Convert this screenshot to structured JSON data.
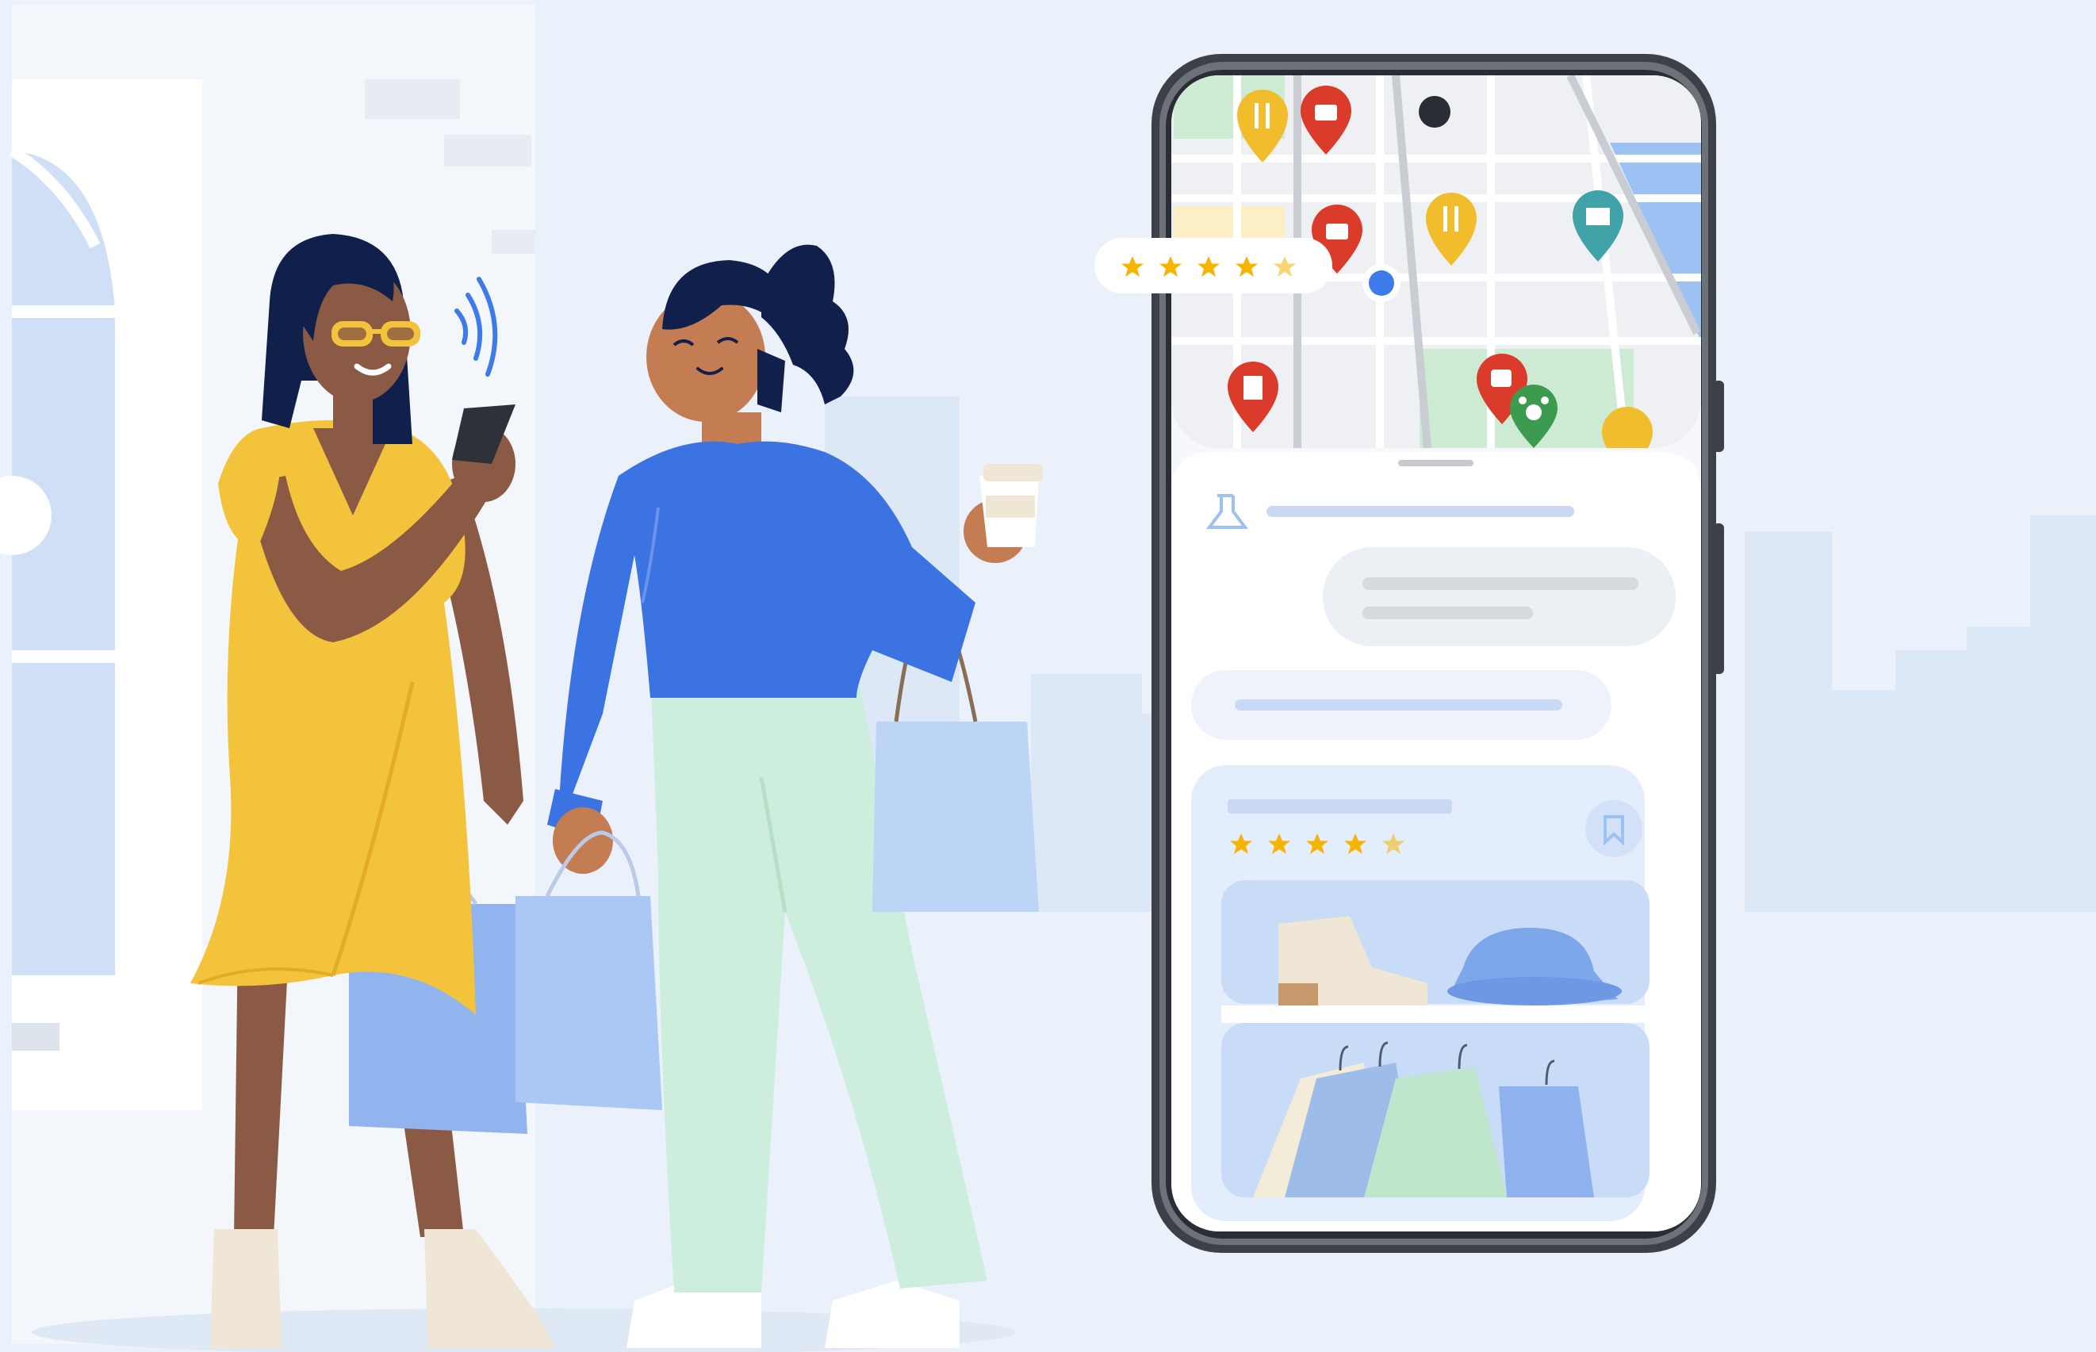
{
  "scene": {
    "description": "",
    "colors": {
      "background": "#eaf1fb",
      "shop_wall": "#f3f6fa",
      "phone_frame": "#3d4047",
      "phone_screen": "#f6f8fc",
      "map_road": "#e8e9ee",
      "map_park": "#cdebd3",
      "map_water": "#9cc1f3",
      "star": "#f5b400",
      "pin_red": "#db3b2b",
      "pin_yellow": "#f1bd2c",
      "pin_teal": "#3fa3a8",
      "pin_green": "#3c9b4f",
      "location_dot": "#3d7bea",
      "chat_bubble": "#eceff3",
      "chat_line": "#c9d9f3",
      "card_bg": "#e3edfb",
      "dress_yellow": "#f4c33c",
      "sweater_blue": "#3c73e2",
      "pants_mint": "#cdeedd",
      "bag_blue": "#aac7f5",
      "boots_cream": "#efe6d6"
    },
    "icons": [
      "phone-map-icon",
      "restaurant-pin-icon",
      "shopping-pin-icon",
      "museum-pin-icon",
      "movie-pin-icon",
      "cafe-pin-icon",
      "pet-pin-icon",
      "location-dot-icon",
      "star-icon",
      "lab-flask-icon",
      "bookmark-icon",
      "sound-waves-icon"
    ],
    "map_rating": {
      "stars_full": 4,
      "stars_half": true
    },
    "card_rating": {
      "stars_full": 4,
      "stars_half": true
    }
  }
}
